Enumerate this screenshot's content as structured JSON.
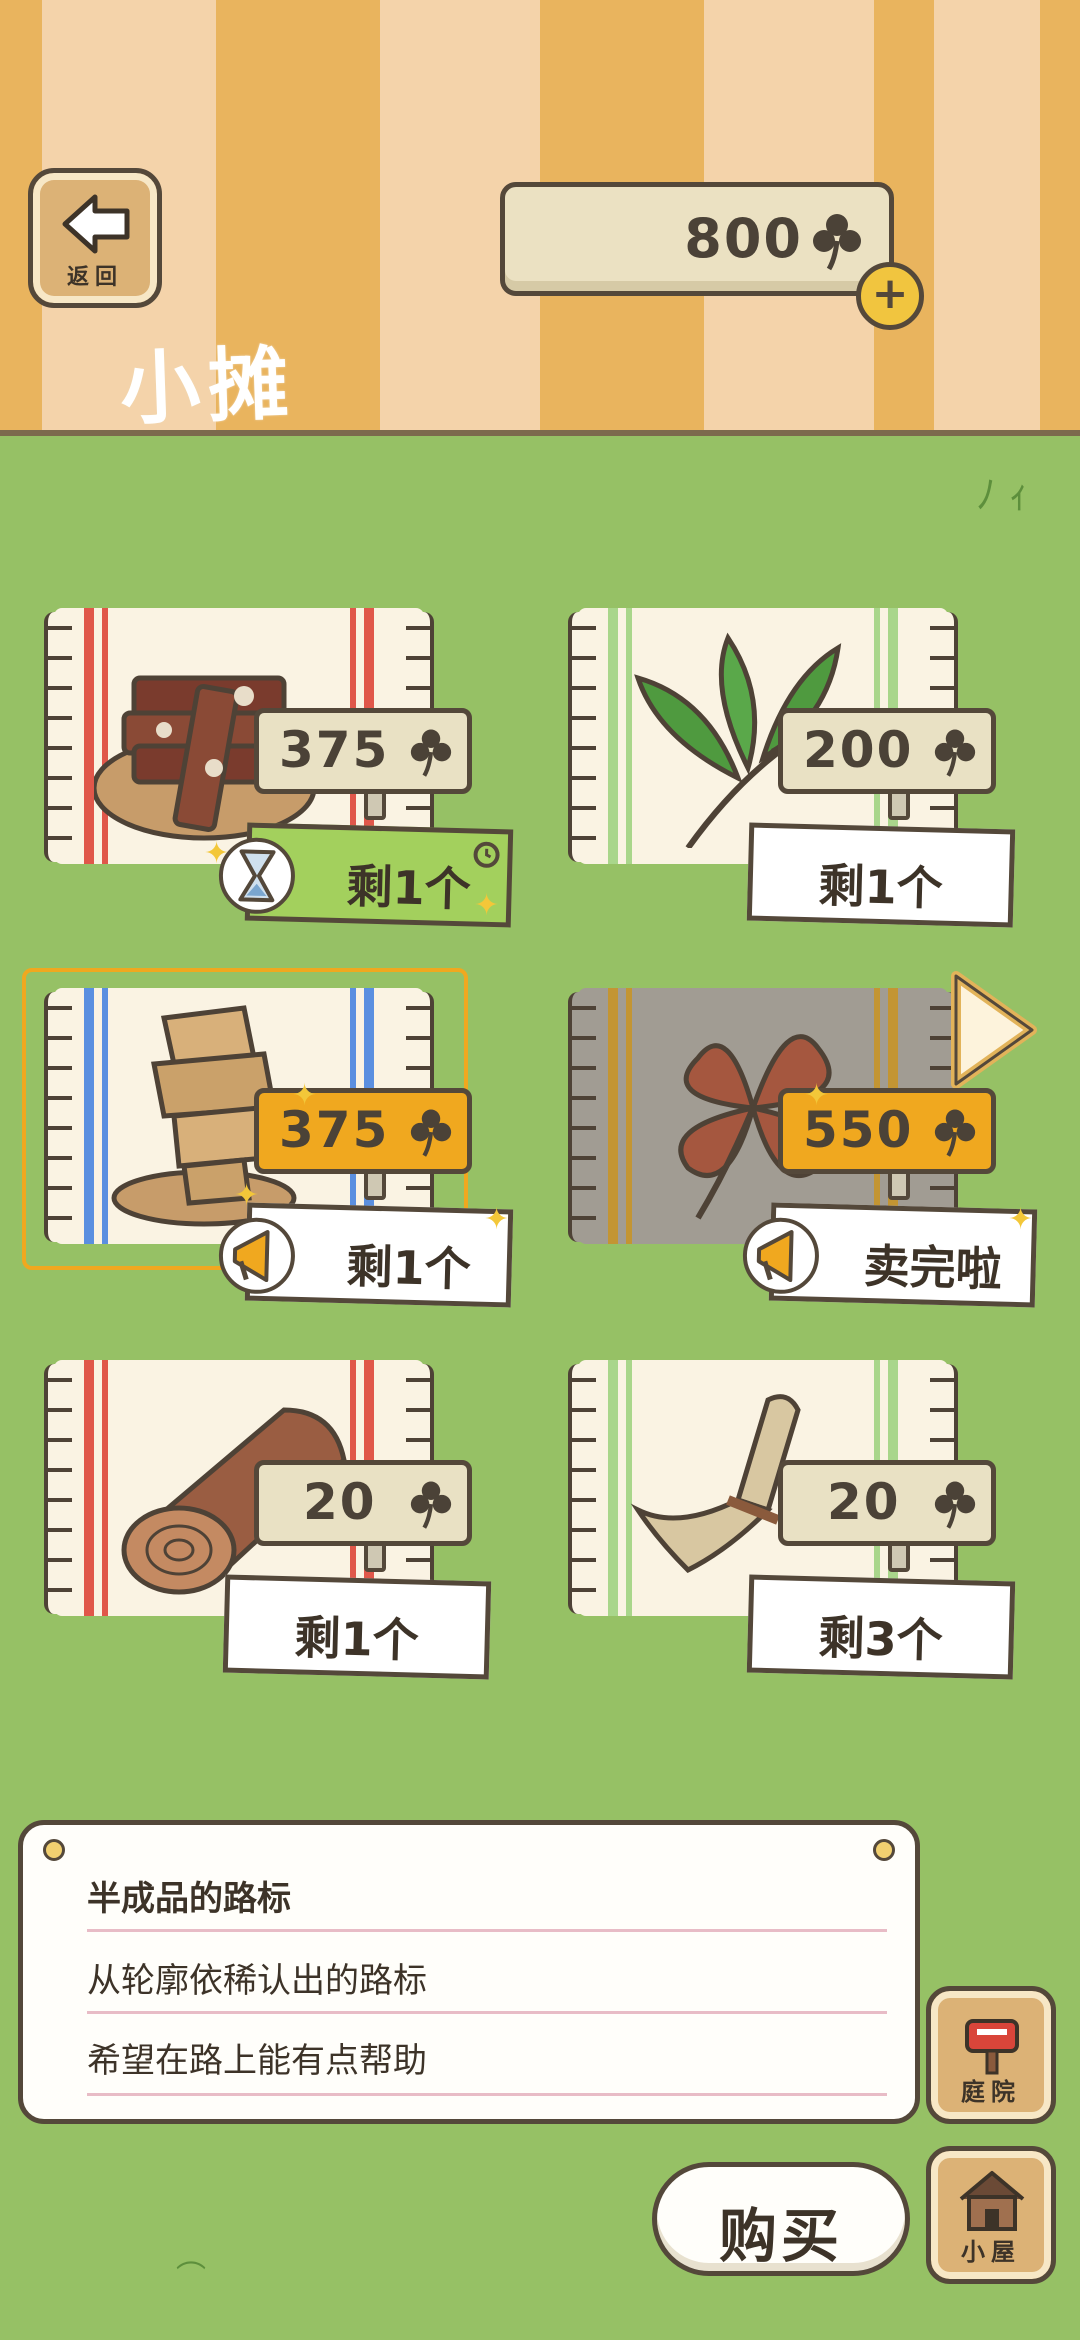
{
  "header": {
    "back_label": "返回",
    "title": "小摊",
    "currency": {
      "value": "800",
      "icon": "clover-icon",
      "add": "+"
    }
  },
  "products": [
    {
      "price": "375",
      "stock": "剩1个",
      "style": "green-timer"
    },
    {
      "price": "200",
      "stock": "剩1个",
      "style": "plain"
    },
    {
      "price": "375",
      "stock": "剩1个",
      "style": "selected-promo"
    },
    {
      "price": "550",
      "stock": "卖完啦",
      "style": "soldout-promo"
    },
    {
      "price": "20",
      "stock": "剩1个",
      "style": "plain"
    },
    {
      "price": "20",
      "stock": "剩3个",
      "style": "plain"
    }
  ],
  "description": {
    "title": "半成品的路标",
    "line1": "从轮廓依稀认出的路标",
    "line2": "希望在路上能有点帮助"
  },
  "buttons": {
    "buy": "购买",
    "yard": "庭院",
    "house": "小屋"
  },
  "colors": {
    "grass": "#96c165",
    "stripe_dark": "#e9b45e",
    "stripe_light": "#f4d3aa",
    "accent_orange": "#f0a81f",
    "outline": "#54483a"
  }
}
